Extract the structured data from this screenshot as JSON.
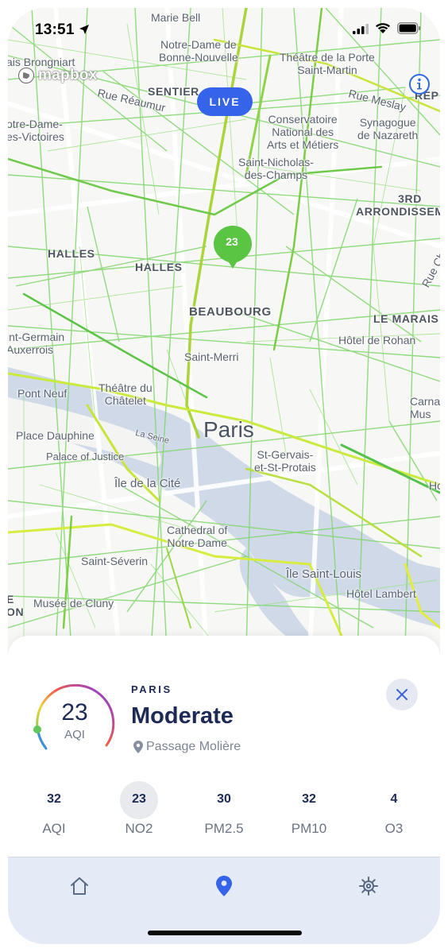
{
  "status_bar": {
    "time": "13:51"
  },
  "map": {
    "attribution": "mapbox",
    "live_badge": "LIVE",
    "marker_value": "23",
    "labels": {
      "marie_bell": "Marie Bell",
      "notre_dame_bn_1": "Notre-Dame de",
      "notre_dame_bn_2": "Bonne-Nouvelle",
      "theatre_porte_1": "Théâtre de la Porte",
      "theatre_porte_2": "Saint-Martin",
      "brongniart": "ais Brongniart",
      "sentier": "SENTIER",
      "rue_meslay": "Rue Meslay",
      "rep": "RÉP",
      "rue_reaumur": "Rue Réaumur",
      "ndv_1": "otre-Dame-",
      "ndv_2": "es-Victoires",
      "conservatoire_1": "Conservatoire",
      "conservatoire_2": "National des",
      "conservatoire_3": "Arts et Métiers",
      "synagogue_1": "Synagogue",
      "synagogue_2": "de Nazareth",
      "snc_1": "Saint-Nicholas-",
      "snc_2": "des-Champs",
      "third_1": "3RD",
      "third_2": "ARRONDISSEM",
      "halles_a": "HALLES",
      "halles_b": "HALLES",
      "rue_cha": "Rue Cha",
      "beaubourg": "BEAUBOURG",
      "le_marais": "LE MARAIS",
      "sgl_1": "int-Germain",
      "sgl_2": "Auxerrois",
      "hotel_rohan": "Hôtel de Rohan",
      "saint_merri": "Saint-Merri",
      "pont_neuf": "Pont Neuf",
      "chatelet_1": "Théâtre du",
      "chatelet_2": "Châtelet",
      "carna_1": "Carna",
      "carna_2": "Mus",
      "la_seine": "La Seine",
      "paris": "Paris",
      "place_dauphine": "Place Dauphine",
      "st_gervais_1": "St-Gervais-",
      "st_gervais_2": "et-St-Protais",
      "palace_justice": "Palace of Justice",
      "ile_cite": "Île de la Cité",
      "ho": "Ho",
      "cathedral_1": "Cathedral of",
      "cathedral_2": "Notre Dame",
      "saint_severin": "Saint-Séverin",
      "ile_saint_louis": "Île Saint-Louis",
      "hotel_lambert": "Hôtel Lambert",
      "e_frag": "E",
      "on_frag": "ON",
      "cluny": "Musée de Cluny"
    }
  },
  "sheet": {
    "city": "PARIS",
    "status": "Moderate",
    "place": "Passage Molière",
    "aqi_value": "23",
    "aqi_label": "AQI",
    "pollutants": [
      {
        "value": "32",
        "name": "AQI"
      },
      {
        "value": "23",
        "name": "NO2"
      },
      {
        "value": "30",
        "name": "PM2.5"
      },
      {
        "value": "32",
        "name": "PM10"
      },
      {
        "value": "4",
        "name": "O3"
      }
    ],
    "active_pollutant": "NO2"
  },
  "tabbar": {
    "tabs": [
      "home-icon",
      "map-pin-icon",
      "gear-icon"
    ],
    "active": "map-pin-icon"
  },
  "colors": {
    "live": "#3563e9",
    "marker": "#5ac543",
    "navy": "#1c2a55",
    "tabbar": "#e4eaf6",
    "active_tab": "#3563e9"
  }
}
